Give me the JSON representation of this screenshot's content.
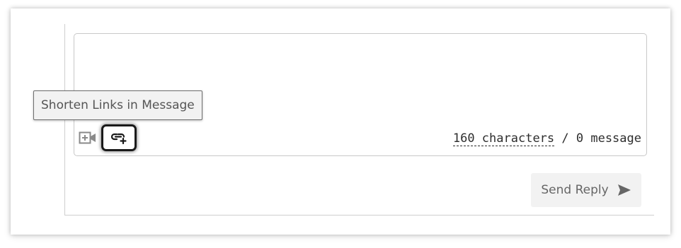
{
  "composer": {
    "message_value": "",
    "video_icon": "video-add-icon",
    "link_icon": "link-plus-icon",
    "tooltip": "Shorten Links in Message"
  },
  "counter": {
    "characters": "160 characters",
    "separator": " / ",
    "messages": "0 message"
  },
  "send": {
    "label": "Send Reply",
    "icon": "send-arrow-icon"
  },
  "colors": {
    "border": "#c8c8c8",
    "button_bg": "#f2f2f2",
    "text": "#2d2d2d",
    "muted_text": "#666666"
  }
}
